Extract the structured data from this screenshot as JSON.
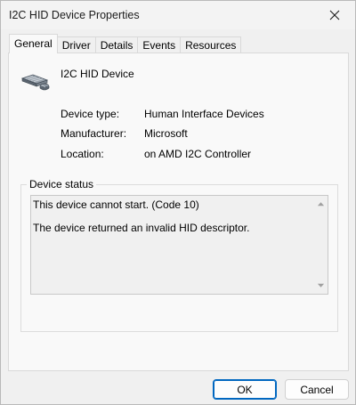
{
  "window": {
    "title": "I2C HID Device Properties"
  },
  "tabs": [
    {
      "label": "General"
    },
    {
      "label": "Driver"
    },
    {
      "label": "Details"
    },
    {
      "label": "Events"
    },
    {
      "label": "Resources"
    }
  ],
  "device": {
    "name": "I2C HID Device",
    "icon": "hid-device-icon"
  },
  "properties": [
    {
      "label": "Device type:",
      "value": "Human Interface Devices"
    },
    {
      "label": "Manufacturer:",
      "value": "Microsoft"
    },
    {
      "label": "Location:",
      "value": "on AMD I2C Controller"
    }
  ],
  "status": {
    "legend": "Device status",
    "line1": "This device cannot start. (Code 10)",
    "line2": "The device returned an invalid HID descriptor."
  },
  "buttons": {
    "ok": "OK",
    "cancel": "Cancel"
  },
  "colors": {
    "accent": "#0067c0",
    "panel": "#f9f9f9",
    "window": "#f0f0f0"
  }
}
